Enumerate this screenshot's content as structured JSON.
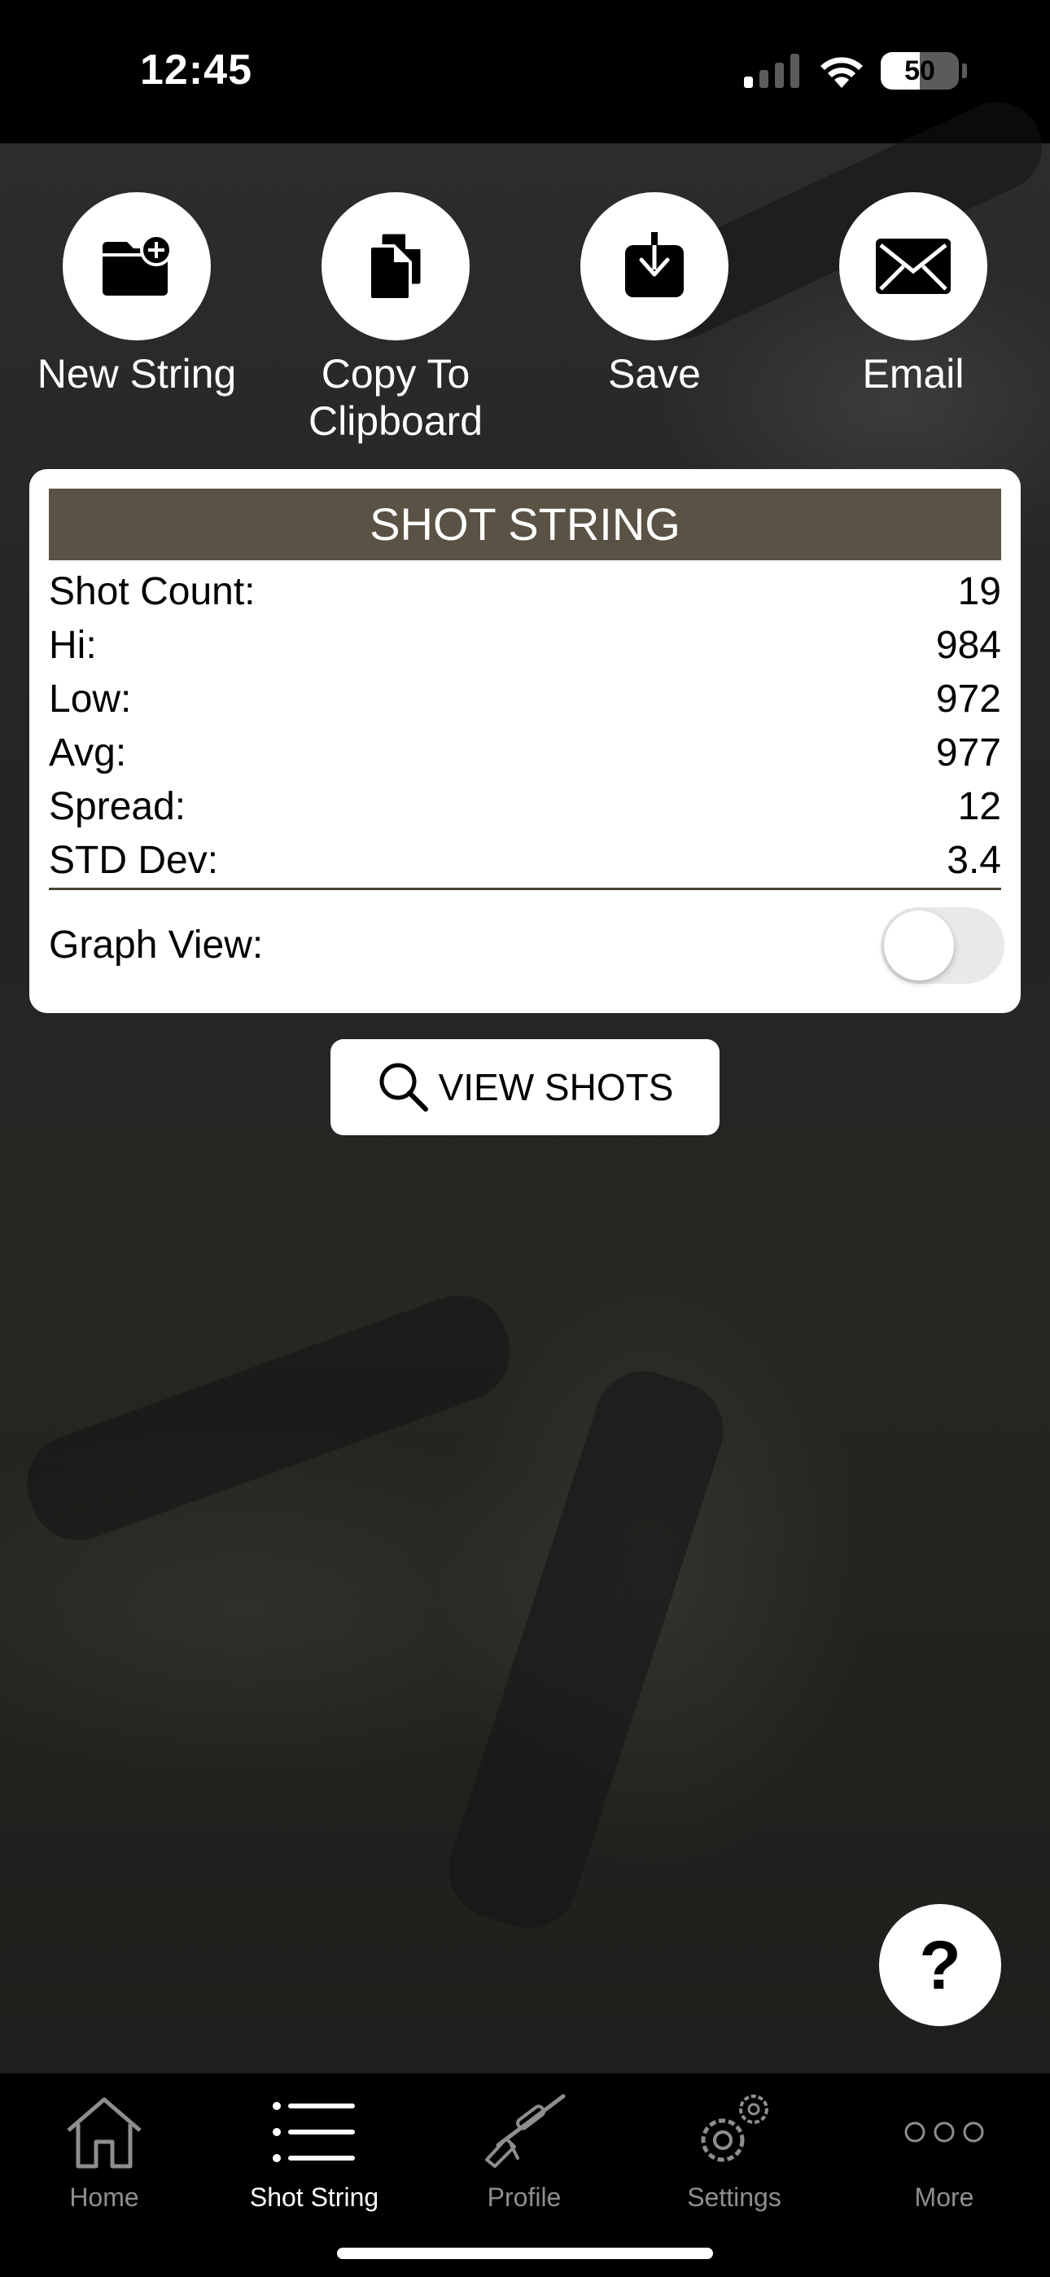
{
  "status_bar": {
    "time": "12:45",
    "battery_level": "50",
    "battery_fraction": 0.5
  },
  "actions": [
    {
      "label": "New String",
      "icon": "folder-plus-icon"
    },
    {
      "label": "Copy To\nClipboard",
      "icon": "copy-icon"
    },
    {
      "label": "Save",
      "icon": "download-icon"
    },
    {
      "label": "Email",
      "icon": "envelope-icon"
    }
  ],
  "card": {
    "title": "SHOT STRING",
    "stats": [
      {
        "label": "Shot Count:",
        "value": "19"
      },
      {
        "label": "Hi:",
        "value": "984"
      },
      {
        "label": "Low:",
        "value": "972"
      },
      {
        "label": "Avg:",
        "value": "977"
      },
      {
        "label": "Spread:",
        "value": "12"
      },
      {
        "label": "STD Dev:",
        "value": "3.4"
      }
    ],
    "graph_view_label": "Graph View:",
    "graph_view_on": false
  },
  "view_shots_label": "VIEW SHOTS",
  "help_label": "?",
  "tabs": [
    {
      "label": "Home",
      "icon": "home-icon",
      "active": false
    },
    {
      "label": "Shot String",
      "icon": "list-icon",
      "active": true
    },
    {
      "label": "Profile",
      "icon": "rifle-icon",
      "active": false
    },
    {
      "label": "Settings",
      "icon": "gear-icon",
      "active": false
    },
    {
      "label": "More",
      "icon": "more-icon",
      "active": false
    }
  ],
  "colors": {
    "header_brown": "#5a5244",
    "background": "#000000",
    "inactive_tab": "#8e8e8e"
  }
}
